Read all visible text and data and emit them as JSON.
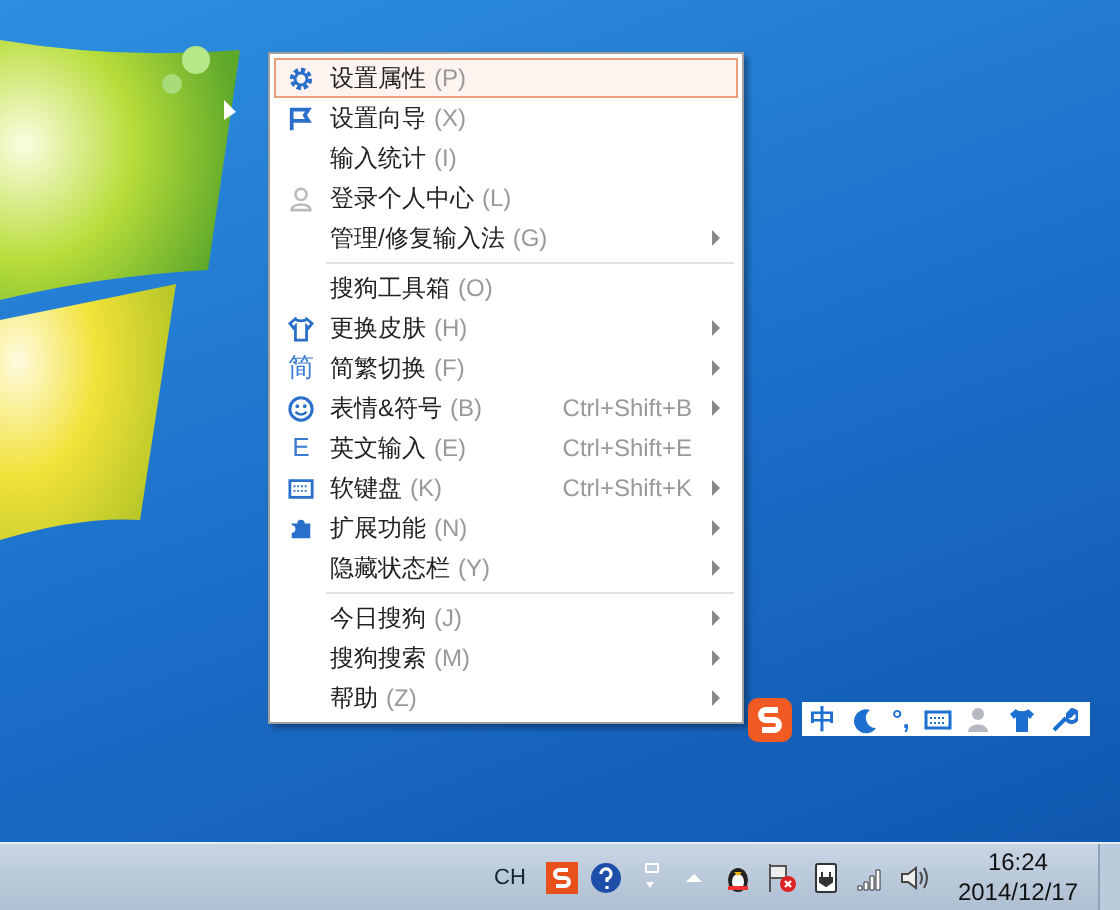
{
  "menu": {
    "sections": [
      [
        {
          "kind": "gear",
          "label": "设置属性",
          "accel": "(P)",
          "submenu": false,
          "selected": true
        },
        {
          "kind": "flag",
          "label": "设置向导",
          "accel": "(X)",
          "submenu": false,
          "selected": false
        },
        {
          "kind": "plain",
          "label": "输入统计",
          "accel": "(I)",
          "submenu": false,
          "selected": false
        },
        {
          "kind": "person",
          "label": "登录个人中心",
          "accel": "(L)",
          "submenu": false,
          "selected": false
        },
        {
          "kind": "plain",
          "label": "管理/修复输入法",
          "accel": "(G)",
          "submenu": true,
          "selected": false
        }
      ],
      [
        {
          "kind": "plain",
          "label": "搜狗工具箱",
          "accel": "(O)",
          "submenu": false,
          "selected": false
        },
        {
          "kind": "shirt",
          "label": "更换皮肤",
          "accel": "(H)",
          "submenu": true,
          "selected": false
        },
        {
          "kind": "glyph",
          "icon_text": "简",
          "label": "简繁切换",
          "accel": "(F)",
          "submenu": true,
          "selected": false
        },
        {
          "kind": "smiley",
          "label": "表情&符号",
          "accel": "(B)",
          "shortcut": "Ctrl+Shift+B",
          "submenu": true,
          "selected": false
        },
        {
          "kind": "glyph",
          "icon_text": "E",
          "label": "英文输入",
          "accel": "(E)",
          "shortcut": "Ctrl+Shift+E",
          "submenu": false,
          "selected": false
        },
        {
          "kind": "keyboard",
          "label": "软键盘",
          "accel": "(K)",
          "shortcut": "Ctrl+Shift+K",
          "submenu": true,
          "selected": false
        },
        {
          "kind": "puzzle",
          "label": "扩展功能",
          "accel": "(N)",
          "submenu": true,
          "selected": false
        },
        {
          "kind": "plain",
          "label": "隐藏状态栏",
          "accel": "(Y)",
          "submenu": true,
          "selected": false
        }
      ],
      [
        {
          "kind": "plain",
          "label": "今日搜狗",
          "accel": "(J)",
          "submenu": true,
          "selected": false
        },
        {
          "kind": "plain",
          "label": "搜狗搜索",
          "accel": "(M)",
          "submenu": true,
          "selected": false
        },
        {
          "kind": "plain",
          "label": "帮助",
          "accel": "(Z)",
          "submenu": true,
          "selected": false
        }
      ]
    ]
  },
  "ime_status_bar": {
    "mode": "中",
    "punctuation": "°,"
  },
  "taskbar": {
    "language": "CH",
    "time": "16:24",
    "date": "2014/12/17"
  }
}
